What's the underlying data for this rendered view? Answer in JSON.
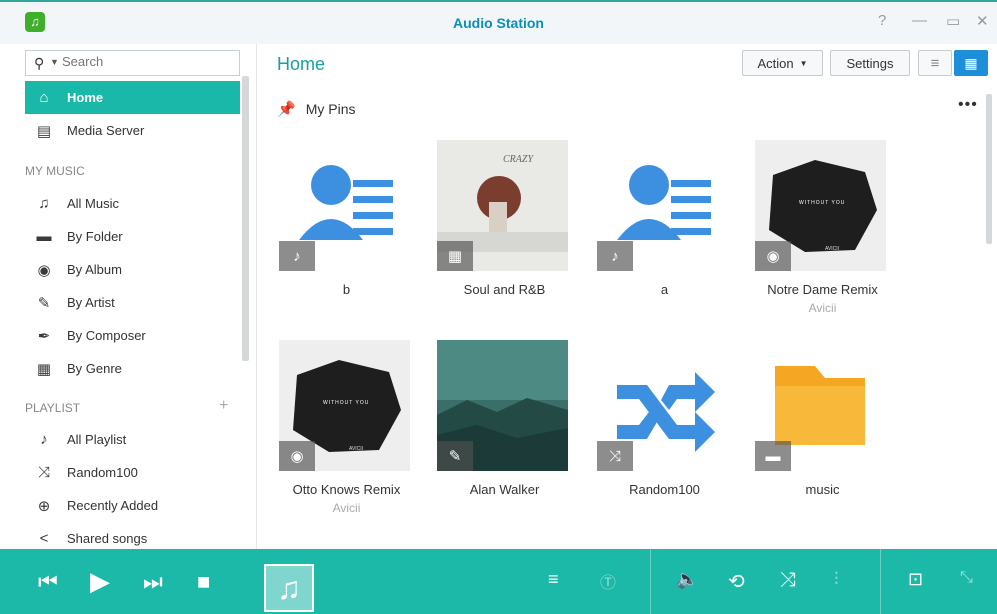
{
  "window": {
    "title": "Audio Station",
    "controls": [
      "?",
      "—",
      "▭",
      "✕"
    ]
  },
  "search": {
    "placeholder": "Search"
  },
  "sidebar": {
    "top_items": [
      {
        "label": "Home",
        "icon": "home-icon"
      },
      {
        "label": "Media Server",
        "icon": "media-server-icon"
      }
    ],
    "my_music_header": "MY MUSIC",
    "my_music_items": [
      {
        "label": "All Music",
        "icon": "music-note-icon"
      },
      {
        "label": "By Folder",
        "icon": "folder-icon"
      },
      {
        "label": "By Album",
        "icon": "album-icon"
      },
      {
        "label": "By Artist",
        "icon": "microphone-icon"
      },
      {
        "label": "By Composer",
        "icon": "pen-icon"
      },
      {
        "label": "By Genre",
        "icon": "grid-icon"
      }
    ],
    "playlist_header": "PLAYLIST",
    "playlist_add": "+",
    "playlist_items": [
      {
        "label": "All Playlist",
        "icon": "playlist-icon"
      },
      {
        "label": "Random100",
        "icon": "shuffle-icon"
      },
      {
        "label": "Recently Added",
        "icon": "plus-circle-icon"
      },
      {
        "label": "Shared songs",
        "icon": "share-icon"
      }
    ]
  },
  "main": {
    "title": "Home",
    "action_label": "Action",
    "settings_label": "Settings",
    "pins_header": "My Pins",
    "more": "•••",
    "pins": [
      {
        "title": "b",
        "subtitle": "",
        "art": "playlist",
        "badge": "playlist-icon"
      },
      {
        "title": "Soul and R&B",
        "subtitle": "",
        "art": "crazy",
        "badge": "grid-icon"
      },
      {
        "title": "a",
        "subtitle": "",
        "art": "playlist",
        "badge": "playlist-icon"
      },
      {
        "title": "Notre Dame Remix",
        "subtitle": "Avicii",
        "art": "avicii",
        "badge": "album-icon"
      },
      {
        "title": "Otto Knows Remix",
        "subtitle": "Avicii",
        "art": "avicii",
        "badge": "album-icon"
      },
      {
        "title": "Alan Walker",
        "subtitle": "",
        "art": "alan",
        "badge": "microphone-icon"
      },
      {
        "title": "Random100",
        "subtitle": "",
        "art": "shuffle",
        "badge": "shuffle-icon"
      },
      {
        "title": "music",
        "subtitle": "",
        "art": "folder",
        "badge": "folder-icon"
      }
    ],
    "art_text": {
      "crazy": "CRAZY",
      "avicii_top": "WITHOUT YOU",
      "avicii_bottom": "AVICII"
    }
  },
  "player": {
    "controls": [
      "previous-icon",
      "play-icon",
      "next-icon",
      "stop-icon",
      "queue-icon",
      "lyrics-icon",
      "volume-icon",
      "repeat-icon",
      "shuffle-icon",
      "equalizer-icon",
      "airplay-icon",
      "minimize-icon"
    ]
  },
  "colors": {
    "accent": "#1cb9a9",
    "title": "#0a8fb8",
    "active_view": "#1c8fd8"
  }
}
